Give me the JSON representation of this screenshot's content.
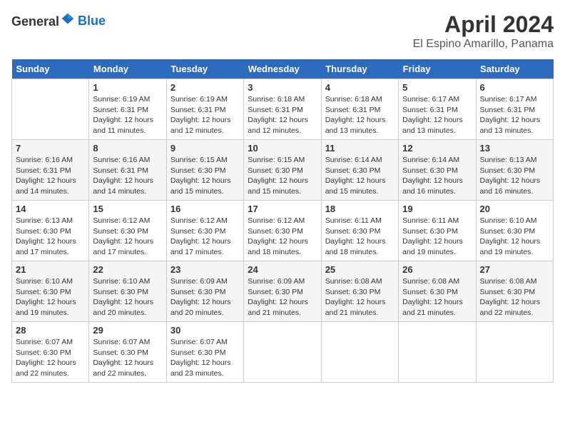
{
  "header": {
    "logo_general": "General",
    "logo_blue": "Blue",
    "title": "April 2024",
    "subtitle": "El Espino Amarillo, Panama"
  },
  "calendar": {
    "days_of_week": [
      "Sunday",
      "Monday",
      "Tuesday",
      "Wednesday",
      "Thursday",
      "Friday",
      "Saturday"
    ],
    "weeks": [
      [
        {
          "day": "",
          "info": ""
        },
        {
          "day": "1",
          "info": "Sunrise: 6:19 AM\nSunset: 6:31 PM\nDaylight: 12 hours and 11 minutes."
        },
        {
          "day": "2",
          "info": "Sunrise: 6:19 AM\nSunset: 6:31 PM\nDaylight: 12 hours and 12 minutes."
        },
        {
          "day": "3",
          "info": "Sunrise: 6:18 AM\nSunset: 6:31 PM\nDaylight: 12 hours and 12 minutes."
        },
        {
          "day": "4",
          "info": "Sunrise: 6:18 AM\nSunset: 6:31 PM\nDaylight: 12 hours and 13 minutes."
        },
        {
          "day": "5",
          "info": "Sunrise: 6:17 AM\nSunset: 6:31 PM\nDaylight: 12 hours and 13 minutes."
        },
        {
          "day": "6",
          "info": "Sunrise: 6:17 AM\nSunset: 6:31 PM\nDaylight: 12 hours and 13 minutes."
        }
      ],
      [
        {
          "day": "7",
          "info": "Sunrise: 6:16 AM\nSunset: 6:31 PM\nDaylight: 12 hours and 14 minutes."
        },
        {
          "day": "8",
          "info": "Sunrise: 6:16 AM\nSunset: 6:31 PM\nDaylight: 12 hours and 14 minutes."
        },
        {
          "day": "9",
          "info": "Sunrise: 6:15 AM\nSunset: 6:30 PM\nDaylight: 12 hours and 15 minutes."
        },
        {
          "day": "10",
          "info": "Sunrise: 6:15 AM\nSunset: 6:30 PM\nDaylight: 12 hours and 15 minutes."
        },
        {
          "day": "11",
          "info": "Sunrise: 6:14 AM\nSunset: 6:30 PM\nDaylight: 12 hours and 15 minutes."
        },
        {
          "day": "12",
          "info": "Sunrise: 6:14 AM\nSunset: 6:30 PM\nDaylight: 12 hours and 16 minutes."
        },
        {
          "day": "13",
          "info": "Sunrise: 6:13 AM\nSunset: 6:30 PM\nDaylight: 12 hours and 16 minutes."
        }
      ],
      [
        {
          "day": "14",
          "info": "Sunrise: 6:13 AM\nSunset: 6:30 PM\nDaylight: 12 hours and 17 minutes."
        },
        {
          "day": "15",
          "info": "Sunrise: 6:12 AM\nSunset: 6:30 PM\nDaylight: 12 hours and 17 minutes."
        },
        {
          "day": "16",
          "info": "Sunrise: 6:12 AM\nSunset: 6:30 PM\nDaylight: 12 hours and 17 minutes."
        },
        {
          "day": "17",
          "info": "Sunrise: 6:12 AM\nSunset: 6:30 PM\nDaylight: 12 hours and 18 minutes."
        },
        {
          "day": "18",
          "info": "Sunrise: 6:11 AM\nSunset: 6:30 PM\nDaylight: 12 hours and 18 minutes."
        },
        {
          "day": "19",
          "info": "Sunrise: 6:11 AM\nSunset: 6:30 PM\nDaylight: 12 hours and 19 minutes."
        },
        {
          "day": "20",
          "info": "Sunrise: 6:10 AM\nSunset: 6:30 PM\nDaylight: 12 hours and 19 minutes."
        }
      ],
      [
        {
          "day": "21",
          "info": "Sunrise: 6:10 AM\nSunset: 6:30 PM\nDaylight: 12 hours and 19 minutes."
        },
        {
          "day": "22",
          "info": "Sunrise: 6:10 AM\nSunset: 6:30 PM\nDaylight: 12 hours and 20 minutes."
        },
        {
          "day": "23",
          "info": "Sunrise: 6:09 AM\nSunset: 6:30 PM\nDaylight: 12 hours and 20 minutes."
        },
        {
          "day": "24",
          "info": "Sunrise: 6:09 AM\nSunset: 6:30 PM\nDaylight: 12 hours and 21 minutes."
        },
        {
          "day": "25",
          "info": "Sunrise: 6:08 AM\nSunset: 6:30 PM\nDaylight: 12 hours and 21 minutes."
        },
        {
          "day": "26",
          "info": "Sunrise: 6:08 AM\nSunset: 6:30 PM\nDaylight: 12 hours and 21 minutes."
        },
        {
          "day": "27",
          "info": "Sunrise: 6:08 AM\nSunset: 6:30 PM\nDaylight: 12 hours and 22 minutes."
        }
      ],
      [
        {
          "day": "28",
          "info": "Sunrise: 6:07 AM\nSunset: 6:30 PM\nDaylight: 12 hours and 22 minutes."
        },
        {
          "day": "29",
          "info": "Sunrise: 6:07 AM\nSunset: 6:30 PM\nDaylight: 12 hours and 22 minutes."
        },
        {
          "day": "30",
          "info": "Sunrise: 6:07 AM\nSunset: 6:30 PM\nDaylight: 12 hours and 23 minutes."
        },
        {
          "day": "",
          "info": ""
        },
        {
          "day": "",
          "info": ""
        },
        {
          "day": "",
          "info": ""
        },
        {
          "day": "",
          "info": ""
        }
      ]
    ]
  }
}
